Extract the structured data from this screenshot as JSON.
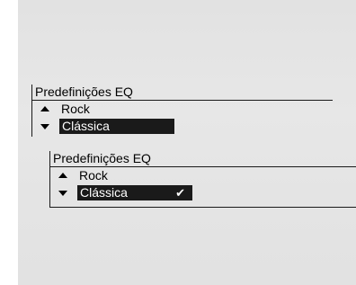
{
  "menu_a": {
    "title": "Predefinições EQ",
    "items": [
      {
        "label": "Rock",
        "arrow": "up-arrow-icon"
      },
      {
        "label": "Clássica",
        "arrow": "down-arrow-icon",
        "selected": true
      }
    ]
  },
  "menu_b": {
    "title": "Predefinições EQ",
    "items": [
      {
        "label": "Rock",
        "arrow": "up-arrow-icon"
      },
      {
        "label": "Clássica",
        "arrow": "down-arrow-icon",
        "selected": true,
        "checked": true
      }
    ],
    "check_glyph": "✔"
  },
  "colors": {
    "background": "#e5e5e5",
    "highlight": "#1a1a1a",
    "text": "#000000",
    "highlight_text": "#ffffff"
  }
}
